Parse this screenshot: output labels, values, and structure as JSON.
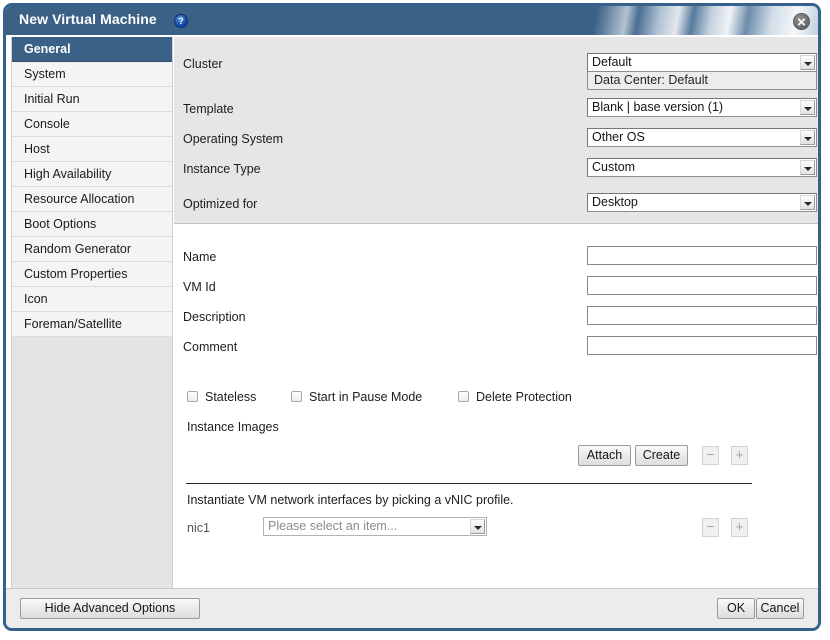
{
  "window": {
    "title": "New Virtual Machine",
    "help_icon": "question-mark-icon",
    "close_icon": "close-icon",
    "accent_color": "#3b6187"
  },
  "sidebar": {
    "items": [
      {
        "label": "General",
        "active": true
      },
      {
        "label": "System",
        "active": false
      },
      {
        "label": "Initial Run",
        "active": false
      },
      {
        "label": "Console",
        "active": false
      },
      {
        "label": "Host",
        "active": false
      },
      {
        "label": "High Availability",
        "active": false
      },
      {
        "label": "Resource Allocation",
        "active": false
      },
      {
        "label": "Boot Options",
        "active": false
      },
      {
        "label": "Random Generator",
        "active": false
      },
      {
        "label": "Custom Properties",
        "active": false
      },
      {
        "label": "Icon",
        "active": false
      },
      {
        "label": "Foreman/Satellite",
        "active": false
      }
    ]
  },
  "form": {
    "cluster": {
      "label": "Cluster",
      "value": "Default",
      "sub_value": "Data Center: Default"
    },
    "template": {
      "label": "Template",
      "value": "Blank | base version (1)"
    },
    "operating_system": {
      "label": "Operating System",
      "value": "Other OS"
    },
    "instance_type": {
      "label": "Instance Type",
      "value": "Custom",
      "icon": "chain-link-icon"
    },
    "optimized_for": {
      "label": "Optimized for",
      "value": "Desktop"
    },
    "name": {
      "label": "Name",
      "value": "",
      "placeholder": ""
    },
    "vm_id": {
      "label": "VM Id",
      "value": "",
      "placeholder": ""
    },
    "description": {
      "label": "Description",
      "value": "",
      "placeholder": ""
    },
    "comment": {
      "label": "Comment",
      "value": "",
      "placeholder": ""
    }
  },
  "checkboxes": [
    {
      "label": "Stateless",
      "checked": false
    },
    {
      "label": "Start in Pause Mode",
      "checked": false
    },
    {
      "label": "Delete Protection",
      "checked": false
    }
  ],
  "instance_images": {
    "label": "Instance Images",
    "attach_label": "Attach",
    "create_label": "Create",
    "remove_label": "−",
    "add_label": "+"
  },
  "network": {
    "hint": "Instantiate VM network interfaces by picking a vNIC profile.",
    "nic_label": "nic1",
    "profile_placeholder": "Please select an item...",
    "remove_label": "−",
    "add_label": "+"
  },
  "footer": {
    "hide_advanced_label": "Hide Advanced Options",
    "ok_label": "OK",
    "cancel_label": "Cancel"
  }
}
